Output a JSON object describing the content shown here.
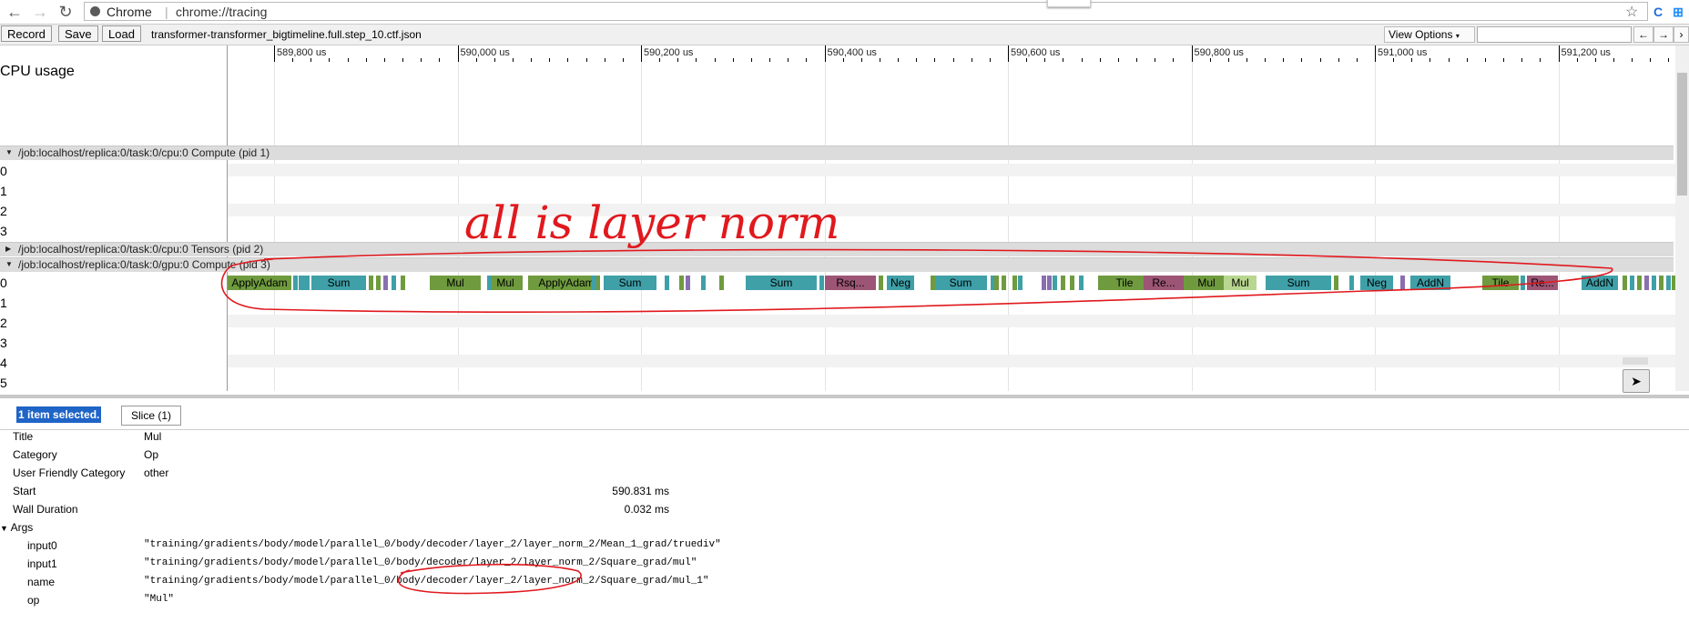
{
  "browser": {
    "app_name": "Chrome",
    "url": "chrome://tracing"
  },
  "toolbar": {
    "record": "Record",
    "save": "Save",
    "load": "Load",
    "filename": "transformer-transformer_bigtimeline.full.step_10.ctf.json",
    "view_options": "View Options",
    "prev": "←",
    "next": "→"
  },
  "ruler": {
    "ticks": [
      "589,800 us",
      "590,000 us",
      "590,200 us",
      "590,400 us",
      "590,600 us",
      "590,800 us",
      "591,000 us",
      "591,200 us"
    ]
  },
  "cpu": {
    "label": "CPU usage"
  },
  "processes": [
    {
      "name": "/job:localhost/replica:0/task:0/cpu:0 Compute (pid 1)",
      "rows": [
        "0",
        "1",
        "2",
        "3"
      ]
    },
    {
      "name": "/job:localhost/replica:0/task:0/cpu:0 Tensors (pid 2)"
    },
    {
      "name": "/job:localhost/replica:0/task:0/gpu:0 Compute (pid 3)",
      "rows": [
        "0",
        "1",
        "2",
        "3",
        "4",
        "5"
      ]
    }
  ],
  "slices": [
    {
      "label": "ApplyAdam",
      "color": "#6f9b3e"
    },
    {
      "label": "",
      "color": "#3fa0a8"
    },
    {
      "label": "Sum",
      "color": "#3fa0a8"
    },
    {
      "label": "Mul",
      "color": "#6f9b3e"
    },
    {
      "label": "Mul",
      "color": "#6f9b3e"
    },
    {
      "label": "ApplyAdam",
      "color": "#6f9b3e"
    },
    {
      "label": "Sum",
      "color": "#3fa0a8"
    },
    {
      "label": "Sum",
      "color": "#3fa0a8"
    },
    {
      "label": "Rsq...",
      "color": "#9d5575"
    },
    {
      "label": "Neg",
      "color": "#3fa0a8"
    },
    {
      "label": "Sum",
      "color": "#3fa0a8"
    },
    {
      "label": "Tile",
      "color": "#6f9b3e"
    },
    {
      "label": "Re...",
      "color": "#9d5575"
    },
    {
      "label": "Mul",
      "color": "#6f9b3e"
    },
    {
      "label": "Mul",
      "color": "#b8d68f"
    },
    {
      "label": "Sum",
      "color": "#3fa0a8"
    },
    {
      "label": "Neg",
      "color": "#3fa0a8"
    },
    {
      "label": "AddN",
      "color": "#3fa0a8"
    },
    {
      "label": "Tile",
      "color": "#6f9b3e"
    },
    {
      "label": "Re...",
      "color": "#9d5575"
    },
    {
      "label": "AddN",
      "color": "#3fa0a8"
    }
  ],
  "annotation": {
    "text": "all is layer norm"
  },
  "analysis": {
    "selected": "1 item selected.",
    "tab": "Slice (1)",
    "fields": [
      {
        "key": "Title",
        "value": "Mul"
      },
      {
        "key": "Category",
        "value": "Op"
      },
      {
        "key": "User Friendly Category",
        "value": "other"
      }
    ],
    "start_key": "Start",
    "start_value": "590.831 ms",
    "wall_key": "Wall Duration",
    "wall_value": "0.032 ms",
    "args_label": "Args",
    "args": [
      {
        "key": "input0",
        "value": "\"training/gradients/body/model/parallel_0/body/decoder/layer_2/layer_norm_2/Mean_1_grad/truediv\""
      },
      {
        "key": "input1",
        "value": "\"training/gradients/body/model/parallel_0/body/decoder/layer_2/layer_norm_2/Square_grad/mul\""
      },
      {
        "key": "name",
        "value": "\"training/gradients/body/model/parallel_0/body/decoder/layer_2/layer_norm_2/Square_grad/mul_1\""
      },
      {
        "key": "op",
        "value": "\"Mul\""
      }
    ]
  }
}
